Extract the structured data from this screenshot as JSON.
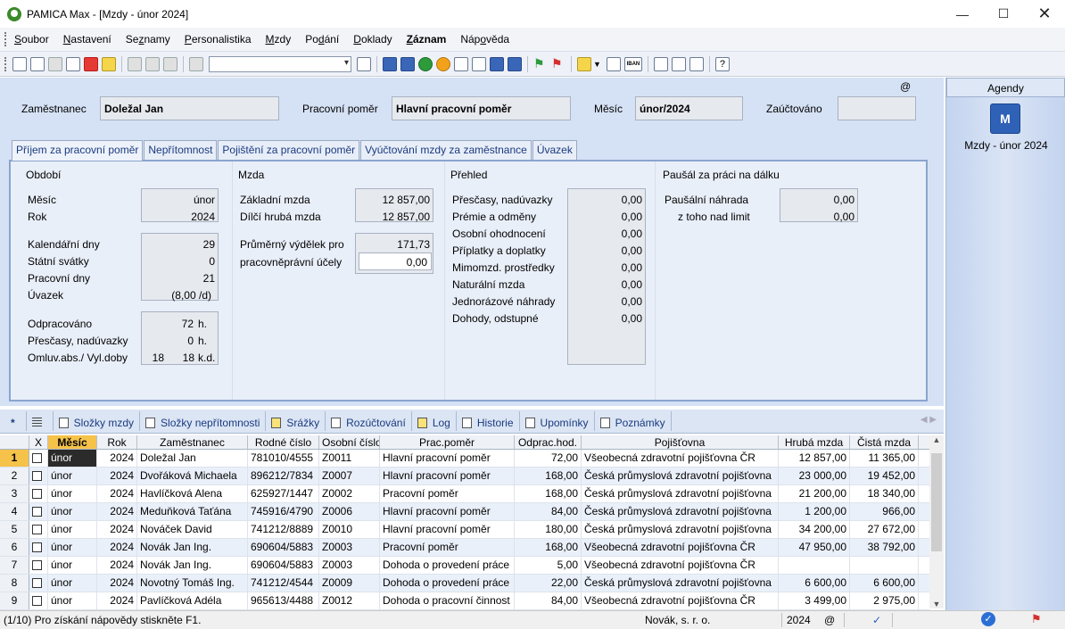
{
  "window": {
    "title": "PAMICA Max - [Mzdy - únor 2024]"
  },
  "menu": [
    {
      "label": "Soubor",
      "u": "S",
      "rest": "oubor"
    },
    {
      "label": "Nastavení",
      "u": "N",
      "rest": "astavení"
    },
    {
      "label": "Seznamy",
      "pre": "Se",
      "u": "z",
      "rest": "namy"
    },
    {
      "label": "Personalistika",
      "u": "P",
      "rest": "ersonalistika"
    },
    {
      "label": "Mzdy",
      "u": "M",
      "rest": "zdy"
    },
    {
      "label": "Podání",
      "pre": "Po",
      "u": "d",
      "rest": "ání"
    },
    {
      "label": "Doklady",
      "u": "D",
      "rest": "oklady"
    },
    {
      "label": "Záznam",
      "u": "Z",
      "rest": "áznam",
      "bold": true
    },
    {
      "label": "Nápověda",
      "pre": "Náp",
      "u": "o",
      "rest": "věda"
    }
  ],
  "header": {
    "employee_label": "Zaměstnanec",
    "employee": "Doležal Jan",
    "relation_label": "Pracovní poměr",
    "relation": "Hlavní pracovní poměr",
    "month_label": "Měsíc",
    "month": "únor/2024",
    "posted_label": "Zaúčtováno",
    "posted": "",
    "at": "@"
  },
  "tabs": [
    "Příjem za pracovní poměr",
    "Nepřítomnost",
    "Pojištění za pracovní poměr",
    "Vyúčtování mzdy za zaměstnance",
    "Úvazek"
  ],
  "obdobi": {
    "title": "Období",
    "mesic_label": "Měsíc",
    "mesic": "únor",
    "rok_label": "Rok",
    "rok": "2024",
    "kal_label": "Kalendářní dny",
    "kal": "29",
    "svatky_label": "Státní svátky",
    "svatky": "0",
    "prac_label": "Pracovní dny",
    "prac": "21",
    "uvazek_label": "Úvazek",
    "uvazek": "(8,00 /d)",
    "odprac_label": "Odpracováno",
    "odprac": "72",
    "odprac_unit": "h.",
    "presc_label": "Přesčasy, nadúvazky",
    "presc": "0",
    "presc_unit": "h.",
    "omluv_label": "Omluv.abs./ Vyl.doby",
    "omluv1": "18",
    "omluv2": "18",
    "omluv_unit": "k.d."
  },
  "mzda": {
    "title": "Mzda",
    "zakl_label": "Základní mzda",
    "zakl": "12 857,00",
    "dilci_label": "Dílčí hrubá mzda",
    "dilci": "12 857,00",
    "prum_label1": "Průměrný výdělek pro",
    "prum_label2": "pracovněprávní účely",
    "prum": "171,73",
    "prum2": "0,00"
  },
  "prehled": {
    "title": "Přehled",
    "items": [
      {
        "label": "Přesčasy, nadúvazky",
        "value": "0,00"
      },
      {
        "label": "Prémie a odměny",
        "value": "0,00"
      },
      {
        "label": "Osobní ohodnocení",
        "value": "0,00"
      },
      {
        "label": "Příplatky a doplatky",
        "value": "0,00"
      },
      {
        "label": "Mimomzd. prostředky",
        "value": "0,00"
      },
      {
        "label": "Naturální mzda",
        "value": "0,00"
      },
      {
        "label": "Jednorázové náhrady",
        "value": "0,00"
      },
      {
        "label": "Dohody, odstupné",
        "value": "0,00"
      }
    ]
  },
  "pausal": {
    "title": "Paušál za práci na dálku",
    "nahrada_label": "Paušální náhrada",
    "nahrada": "0,00",
    "limit_label": "z toho nad limit",
    "limit": "0,00"
  },
  "agendy": {
    "title": "Agendy",
    "item": "Mzdy - únor 2024",
    "icon_letter": "M"
  },
  "subtabs": [
    {
      "label": "*",
      "icon": ""
    },
    {
      "label": "",
      "icon": "filter-icon"
    },
    {
      "label": "Složky mzdy",
      "icon": "list-icon"
    },
    {
      "label": "Složky nepřítomnosti",
      "icon": "list-icon"
    },
    {
      "label": "Srážky",
      "icon": "note-icon"
    },
    {
      "label": "Rozúčtování",
      "icon": "list-icon"
    },
    {
      "label": "Log",
      "icon": "note-icon"
    },
    {
      "label": "Historie",
      "icon": "doc-icon"
    },
    {
      "label": "Upomínky",
      "icon": "list-icon"
    },
    {
      "label": "Poznámky",
      "icon": "doc-icon"
    }
  ],
  "grid": {
    "headers": [
      "",
      "X",
      "Měsíc",
      "Rok",
      "Zaměstnanec",
      "Rodné číslo",
      "Osobní číslo",
      "Prac.poměr",
      "Odprac.hod.",
      "Pojišťovna",
      "Hrubá mzda",
      "Čistá mzda"
    ],
    "rows": [
      [
        "1",
        "únor",
        "2024",
        "Doležal Jan",
        "781010/4555",
        "Z0011",
        "Hlavní pracovní poměr",
        "72,00",
        "Všeobecná zdravotní pojišťovna ČR",
        "12 857,00",
        "11 365,00"
      ],
      [
        "2",
        "únor",
        "2024",
        "Dvořáková Michaela",
        "896212/7834",
        "Z0007",
        "Hlavní pracovní poměr",
        "168,00",
        "Česká průmyslová zdravotní pojišťovna",
        "23 000,00",
        "19 452,00"
      ],
      [
        "3",
        "únor",
        "2024",
        "Havlíčková Alena",
        "625927/1447",
        "Z0002",
        "Pracovní poměr",
        "168,00",
        "Česká průmyslová zdravotní pojišťovna",
        "21 200,00",
        "18 340,00"
      ],
      [
        "4",
        "únor",
        "2024",
        "Meduňková Taťána",
        "745916/4790",
        "Z0006",
        "Hlavní pracovní poměr",
        "84,00",
        "Česká průmyslová zdravotní pojišťovna",
        "1 200,00",
        "966,00"
      ],
      [
        "5",
        "únor",
        "2024",
        "Nováček David",
        "741212/8889",
        "Z0010",
        "Hlavní pracovní poměr",
        "180,00",
        "Česká průmyslová zdravotní pojišťovna",
        "34 200,00",
        "27 672,00"
      ],
      [
        "6",
        "únor",
        "2024",
        "Novák Jan Ing.",
        "690604/5883",
        "Z0003",
        "Pracovní poměr",
        "168,00",
        "Všeobecná zdravotní pojišťovna ČR",
        "47 950,00",
        "38 792,00"
      ],
      [
        "7",
        "únor",
        "2024",
        "Novák Jan Ing.",
        "690604/5883",
        "Z0003",
        "Dohoda o provedení práce",
        "5,00",
        "Všeobecná zdravotní pojišťovna ČR",
        "",
        ""
      ],
      [
        "8",
        "únor",
        "2024",
        "Novotný Tomáš Ing.",
        "741212/4544",
        "Z0009",
        "Dohoda o provedení práce",
        "22,00",
        "Česká průmyslová zdravotní pojišťovna",
        "6 600,00",
        "6 600,00"
      ],
      [
        "9",
        "únor",
        "2024",
        "Pavlíčková Adéla",
        "965613/4488",
        "Z0012",
        "Dohoda o pracovní činnost",
        "84,00",
        "Všeobecná zdravotní pojišťovna ČR",
        "3 499,00",
        "2 975,00"
      ]
    ]
  },
  "status": {
    "hint": "(1/10) Pro získání nápovědy stiskněte F1.",
    "company": "Novák, s. r. o.",
    "year": "2024",
    "at": "@"
  }
}
